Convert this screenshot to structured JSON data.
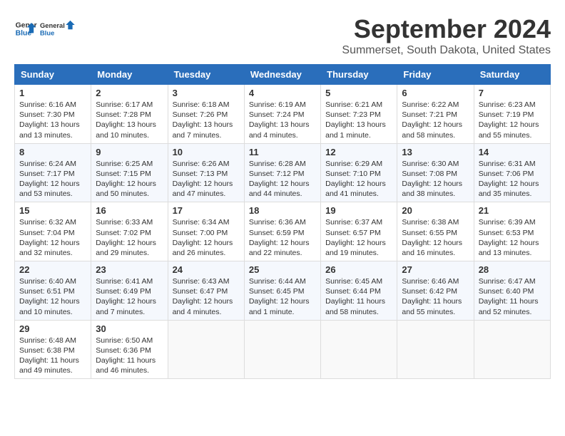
{
  "logo": {
    "line1": "General",
    "line2": "Blue"
  },
  "title": "September 2024",
  "subtitle": "Summerset, South Dakota, United States",
  "days_of_week": [
    "Sunday",
    "Monday",
    "Tuesday",
    "Wednesday",
    "Thursday",
    "Friday",
    "Saturday"
  ],
  "weeks": [
    [
      {
        "day": "1",
        "text": "Sunrise: 6:16 AM\nSunset: 7:30 PM\nDaylight: 13 hours\nand 13 minutes."
      },
      {
        "day": "2",
        "text": "Sunrise: 6:17 AM\nSunset: 7:28 PM\nDaylight: 13 hours\nand 10 minutes."
      },
      {
        "day": "3",
        "text": "Sunrise: 6:18 AM\nSunset: 7:26 PM\nDaylight: 13 hours\nand 7 minutes."
      },
      {
        "day": "4",
        "text": "Sunrise: 6:19 AM\nSunset: 7:24 PM\nDaylight: 13 hours\nand 4 minutes."
      },
      {
        "day": "5",
        "text": "Sunrise: 6:21 AM\nSunset: 7:23 PM\nDaylight: 13 hours\nand 1 minute."
      },
      {
        "day": "6",
        "text": "Sunrise: 6:22 AM\nSunset: 7:21 PM\nDaylight: 12 hours\nand 58 minutes."
      },
      {
        "day": "7",
        "text": "Sunrise: 6:23 AM\nSunset: 7:19 PM\nDaylight: 12 hours\nand 55 minutes."
      }
    ],
    [
      {
        "day": "8",
        "text": "Sunrise: 6:24 AM\nSunset: 7:17 PM\nDaylight: 12 hours\nand 53 minutes."
      },
      {
        "day": "9",
        "text": "Sunrise: 6:25 AM\nSunset: 7:15 PM\nDaylight: 12 hours\nand 50 minutes."
      },
      {
        "day": "10",
        "text": "Sunrise: 6:26 AM\nSunset: 7:13 PM\nDaylight: 12 hours\nand 47 minutes."
      },
      {
        "day": "11",
        "text": "Sunrise: 6:28 AM\nSunset: 7:12 PM\nDaylight: 12 hours\nand 44 minutes."
      },
      {
        "day": "12",
        "text": "Sunrise: 6:29 AM\nSunset: 7:10 PM\nDaylight: 12 hours\nand 41 minutes."
      },
      {
        "day": "13",
        "text": "Sunrise: 6:30 AM\nSunset: 7:08 PM\nDaylight: 12 hours\nand 38 minutes."
      },
      {
        "day": "14",
        "text": "Sunrise: 6:31 AM\nSunset: 7:06 PM\nDaylight: 12 hours\nand 35 minutes."
      }
    ],
    [
      {
        "day": "15",
        "text": "Sunrise: 6:32 AM\nSunset: 7:04 PM\nDaylight: 12 hours\nand 32 minutes."
      },
      {
        "day": "16",
        "text": "Sunrise: 6:33 AM\nSunset: 7:02 PM\nDaylight: 12 hours\nand 29 minutes."
      },
      {
        "day": "17",
        "text": "Sunrise: 6:34 AM\nSunset: 7:00 PM\nDaylight: 12 hours\nand 26 minutes."
      },
      {
        "day": "18",
        "text": "Sunrise: 6:36 AM\nSunset: 6:59 PM\nDaylight: 12 hours\nand 22 minutes."
      },
      {
        "day": "19",
        "text": "Sunrise: 6:37 AM\nSunset: 6:57 PM\nDaylight: 12 hours\nand 19 minutes."
      },
      {
        "day": "20",
        "text": "Sunrise: 6:38 AM\nSunset: 6:55 PM\nDaylight: 12 hours\nand 16 minutes."
      },
      {
        "day": "21",
        "text": "Sunrise: 6:39 AM\nSunset: 6:53 PM\nDaylight: 12 hours\nand 13 minutes."
      }
    ],
    [
      {
        "day": "22",
        "text": "Sunrise: 6:40 AM\nSunset: 6:51 PM\nDaylight: 12 hours\nand 10 minutes."
      },
      {
        "day": "23",
        "text": "Sunrise: 6:41 AM\nSunset: 6:49 PM\nDaylight: 12 hours\nand 7 minutes."
      },
      {
        "day": "24",
        "text": "Sunrise: 6:43 AM\nSunset: 6:47 PM\nDaylight: 12 hours\nand 4 minutes."
      },
      {
        "day": "25",
        "text": "Sunrise: 6:44 AM\nSunset: 6:45 PM\nDaylight: 12 hours\nand 1 minute."
      },
      {
        "day": "26",
        "text": "Sunrise: 6:45 AM\nSunset: 6:44 PM\nDaylight: 11 hours\nand 58 minutes."
      },
      {
        "day": "27",
        "text": "Sunrise: 6:46 AM\nSunset: 6:42 PM\nDaylight: 11 hours\nand 55 minutes."
      },
      {
        "day": "28",
        "text": "Sunrise: 6:47 AM\nSunset: 6:40 PM\nDaylight: 11 hours\nand 52 minutes."
      }
    ],
    [
      {
        "day": "29",
        "text": "Sunrise: 6:48 AM\nSunset: 6:38 PM\nDaylight: 11 hours\nand 49 minutes."
      },
      {
        "day": "30",
        "text": "Sunrise: 6:50 AM\nSunset: 6:36 PM\nDaylight: 11 hours\nand 46 minutes."
      },
      {
        "day": "",
        "text": ""
      },
      {
        "day": "",
        "text": ""
      },
      {
        "day": "",
        "text": ""
      },
      {
        "day": "",
        "text": ""
      },
      {
        "day": "",
        "text": ""
      }
    ]
  ]
}
